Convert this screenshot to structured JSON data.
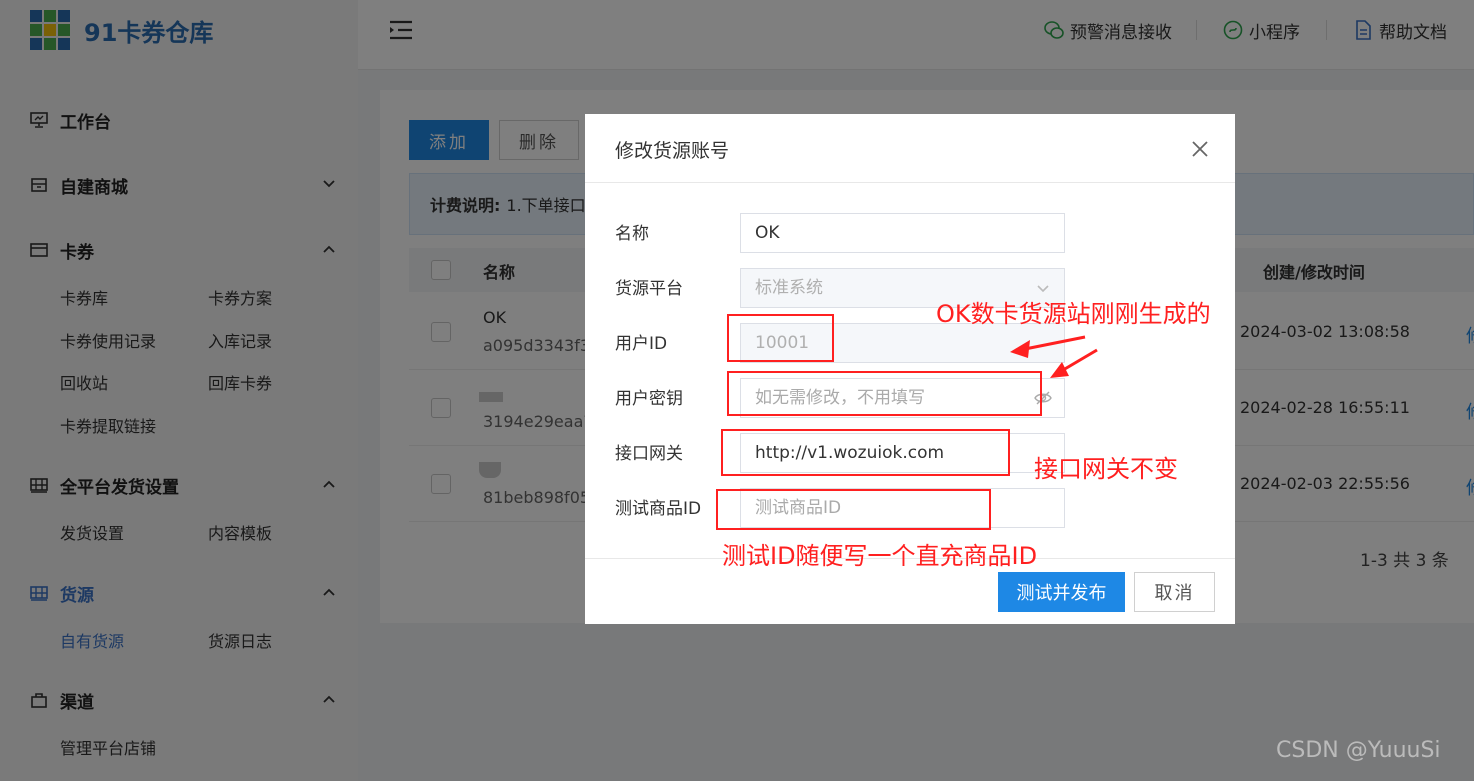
{
  "app": {
    "brand": "91卡券仓库"
  },
  "header": {
    "alerts": "预警消息接收",
    "miniprogram": "小程序",
    "docs": "帮助文档"
  },
  "sidebar": {
    "workbench": "工作台",
    "mall": "自建商城",
    "coupons": {
      "label": "卡券",
      "items": [
        "卡券库",
        "卡券方案",
        "卡券使用记录",
        "入库记录",
        "回收站",
        "回库卡券",
        "卡券提取链接"
      ]
    },
    "delivery": {
      "label": "全平台发货设置",
      "items": [
        "发货设置",
        "内容模板"
      ]
    },
    "supply": {
      "label": "货源",
      "items": [
        "自有货源",
        "货源日志"
      ]
    },
    "channel": {
      "label": "渠道",
      "items": [
        "管理平台店铺"
      ]
    }
  },
  "toolbar": {
    "add": "添加",
    "delete": "删除"
  },
  "notice": {
    "label": "计费说明:",
    "text": "1.下单接口"
  },
  "table": {
    "col_name": "名称",
    "col_time": "创建/修改时间",
    "rows": [
      {
        "name": "OK",
        "id": "a095d3343f3",
        "time": "2024-03-02 13:08:58"
      },
      {
        "name": "",
        "id": "3194e29eaa7",
        "time": "2024-02-28 16:55:11"
      },
      {
        "name": "",
        "id": "81beb898f05",
        "time": "2024-02-03 22:55:56"
      }
    ],
    "edge_link": "修"
  },
  "pager": {
    "summary": "1-3 共 3 条"
  },
  "modal": {
    "title": "修改货源账号",
    "fields": {
      "name": {
        "label": "名称",
        "value": "OK"
      },
      "platform": {
        "label": "货源平台",
        "value": "标准系统"
      },
      "user_id": {
        "label": "用户ID",
        "value": "10001"
      },
      "secret": {
        "label": "用户密钥",
        "placeholder": "如无需修改，不用填写"
      },
      "gateway": {
        "label": "接口网关",
        "value": "http://v1.wozuiok.com"
      },
      "test_id": {
        "label": "测试商品ID",
        "placeholder": "测试商品ID"
      }
    },
    "submit": "测试并发布",
    "cancel": "取消"
  },
  "annotations": {
    "generated": "OK数卡货源站刚刚生成的",
    "gateway_same": "接口网关不变",
    "test_hint": "测试ID随便写一个直充商品ID"
  },
  "watermark": "CSDN @YuuuSi",
  "colors": {
    "primary": "#1e88e5",
    "brand": "#2b6cb0",
    "annotation": "#ff2020"
  }
}
